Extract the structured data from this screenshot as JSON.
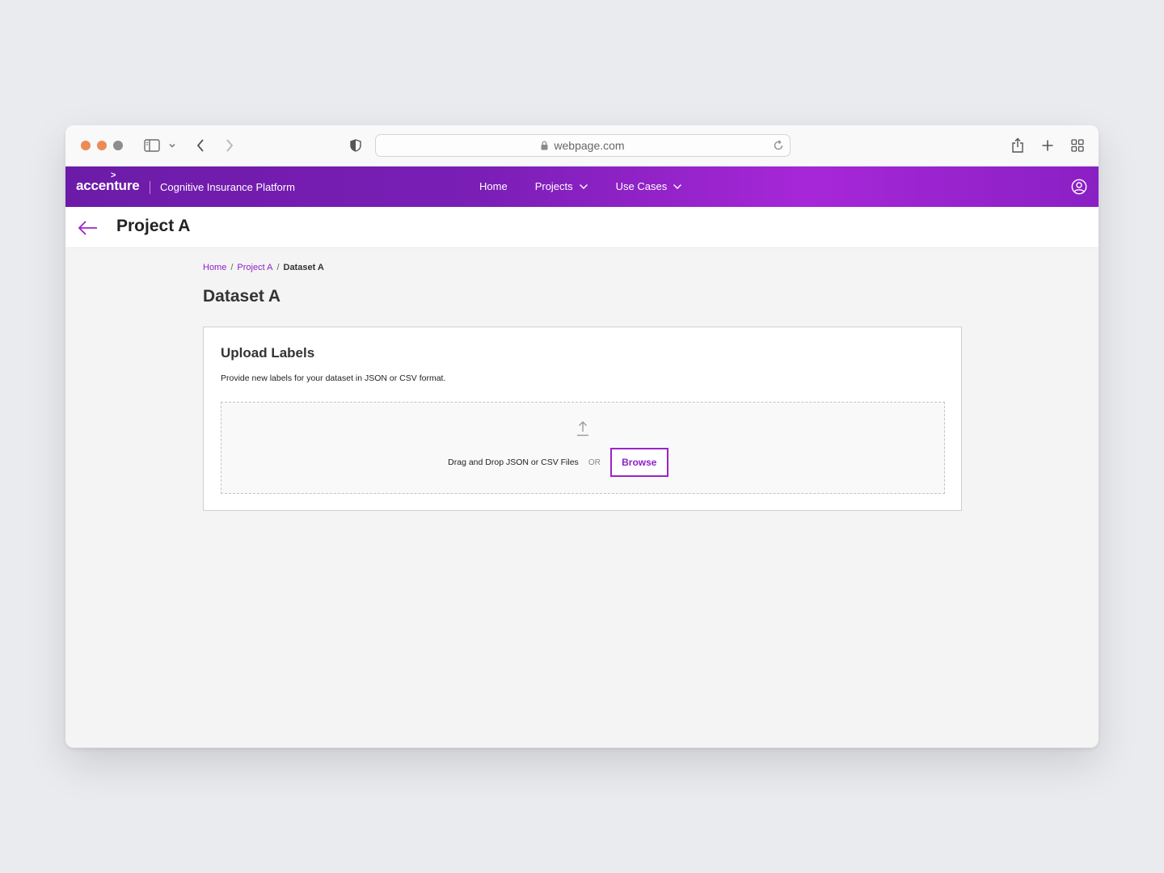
{
  "browser": {
    "url": "webpage.com"
  },
  "app": {
    "brand_logo": "accenture",
    "brand_name": "Cognitive Insurance Platform",
    "nav": [
      {
        "label": "Home"
      },
      {
        "label": "Projects"
      },
      {
        "label": "Use Cases"
      }
    ]
  },
  "page": {
    "title": "Project A"
  },
  "breadcrumb": {
    "home": "Home",
    "project": "Project A",
    "current": "Dataset A"
  },
  "section": {
    "title": "Dataset A"
  },
  "upload": {
    "title": "Upload Labels",
    "description": "Provide new labels for your dataset in JSON or CSV format.",
    "dropzone_text": "Drag and Drop JSON or CSV Files",
    "or_text": "OR",
    "browse_label": "Browse"
  },
  "colors": {
    "accent": "#8e1fc8",
    "header_start": "#6c1ba8",
    "header_end": "#a727d8"
  }
}
